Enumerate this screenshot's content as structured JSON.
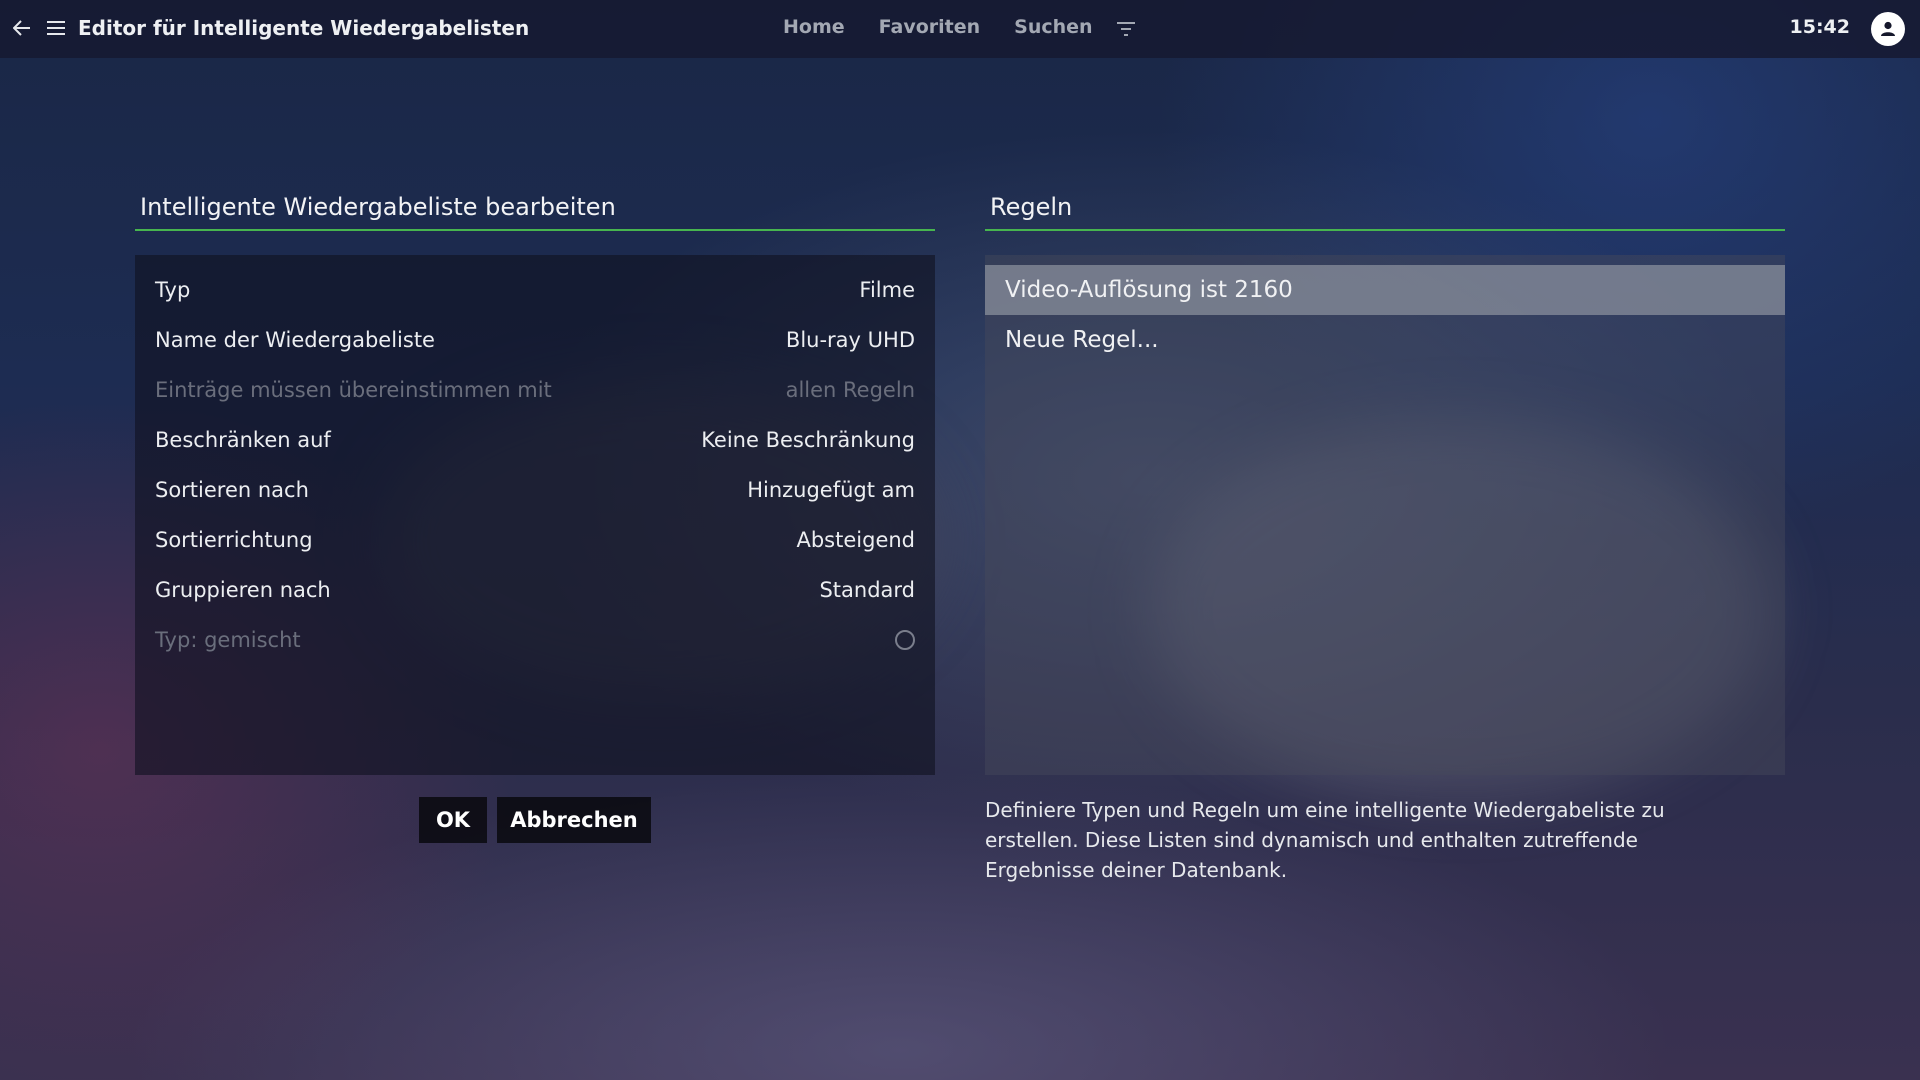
{
  "topbar": {
    "title": "Editor für Intelligente Wiedergabelisten",
    "nav": [
      "Home",
      "Favoriten",
      "Suchen"
    ],
    "clock": "15:42",
    "icons": {
      "back": "back-arrow-icon",
      "menu": "hamburger-menu-icon",
      "filter": "filter-icon",
      "user": "user-icon"
    }
  },
  "left_panel": {
    "header": "Intelligente Wiedergabeliste bearbeiten",
    "rows": [
      {
        "label": "Typ",
        "value": "Filme",
        "enabled": true
      },
      {
        "label": "Name der Wiedergabeliste",
        "value": "Blu-ray UHD",
        "enabled": true
      },
      {
        "label": "Einträge müssen übereinstimmen mit",
        "value": "allen Regeln",
        "enabled": false
      },
      {
        "label": "Beschränken auf",
        "value": "Keine Beschränkung",
        "enabled": true
      },
      {
        "label": "Sortieren nach",
        "value": "Hinzugefügt am",
        "enabled": true
      },
      {
        "label": "Sortierrichtung",
        "value": "Absteigend",
        "enabled": true
      },
      {
        "label": "Gruppieren nach",
        "value": "Standard",
        "enabled": true
      },
      {
        "label": "Typ: gemischt",
        "value": "",
        "enabled": false,
        "toggle": false
      }
    ]
  },
  "right_panel": {
    "header": "Regeln",
    "rules": [
      "Video-Auflösung ist 2160",
      "Neue Regel..."
    ],
    "selected_index": 0
  },
  "buttons": {
    "ok": "OK",
    "cancel": "Abbrechen"
  },
  "description": "Definiere Typen und Regeln um eine intelligente Wiedergabeliste zu erstellen. Diese Listen sind dynamisch und enthalten zutreffende Ergebnisse deiner Datenbank.",
  "colors": {
    "accent": "#47b54f",
    "selected_row": "#8c929e",
    "disabled_text": "#6a6e7c"
  }
}
